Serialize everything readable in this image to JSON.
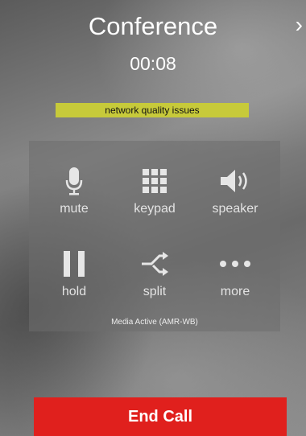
{
  "header": {
    "title": "Conference",
    "timer": "00:08",
    "close_icon": "chevron-right-icon"
  },
  "status": {
    "network_quality": "network quality issues",
    "highlight_color": "#c7ca3a"
  },
  "controls": [
    {
      "label": "mute",
      "icon": "microphone-icon"
    },
    {
      "label": "keypad",
      "icon": "keypad-grid-icon"
    },
    {
      "label": "speaker",
      "icon": "speaker-icon"
    },
    {
      "label": "hold",
      "icon": "pause-icon"
    },
    {
      "label": "split",
      "icon": "split-arrows-icon"
    },
    {
      "label": "more",
      "icon": "more-dots-icon"
    }
  ],
  "media_status": "Media Active (AMR-WB)",
  "end_call": {
    "label": "End Call",
    "color": "#e0201d"
  }
}
